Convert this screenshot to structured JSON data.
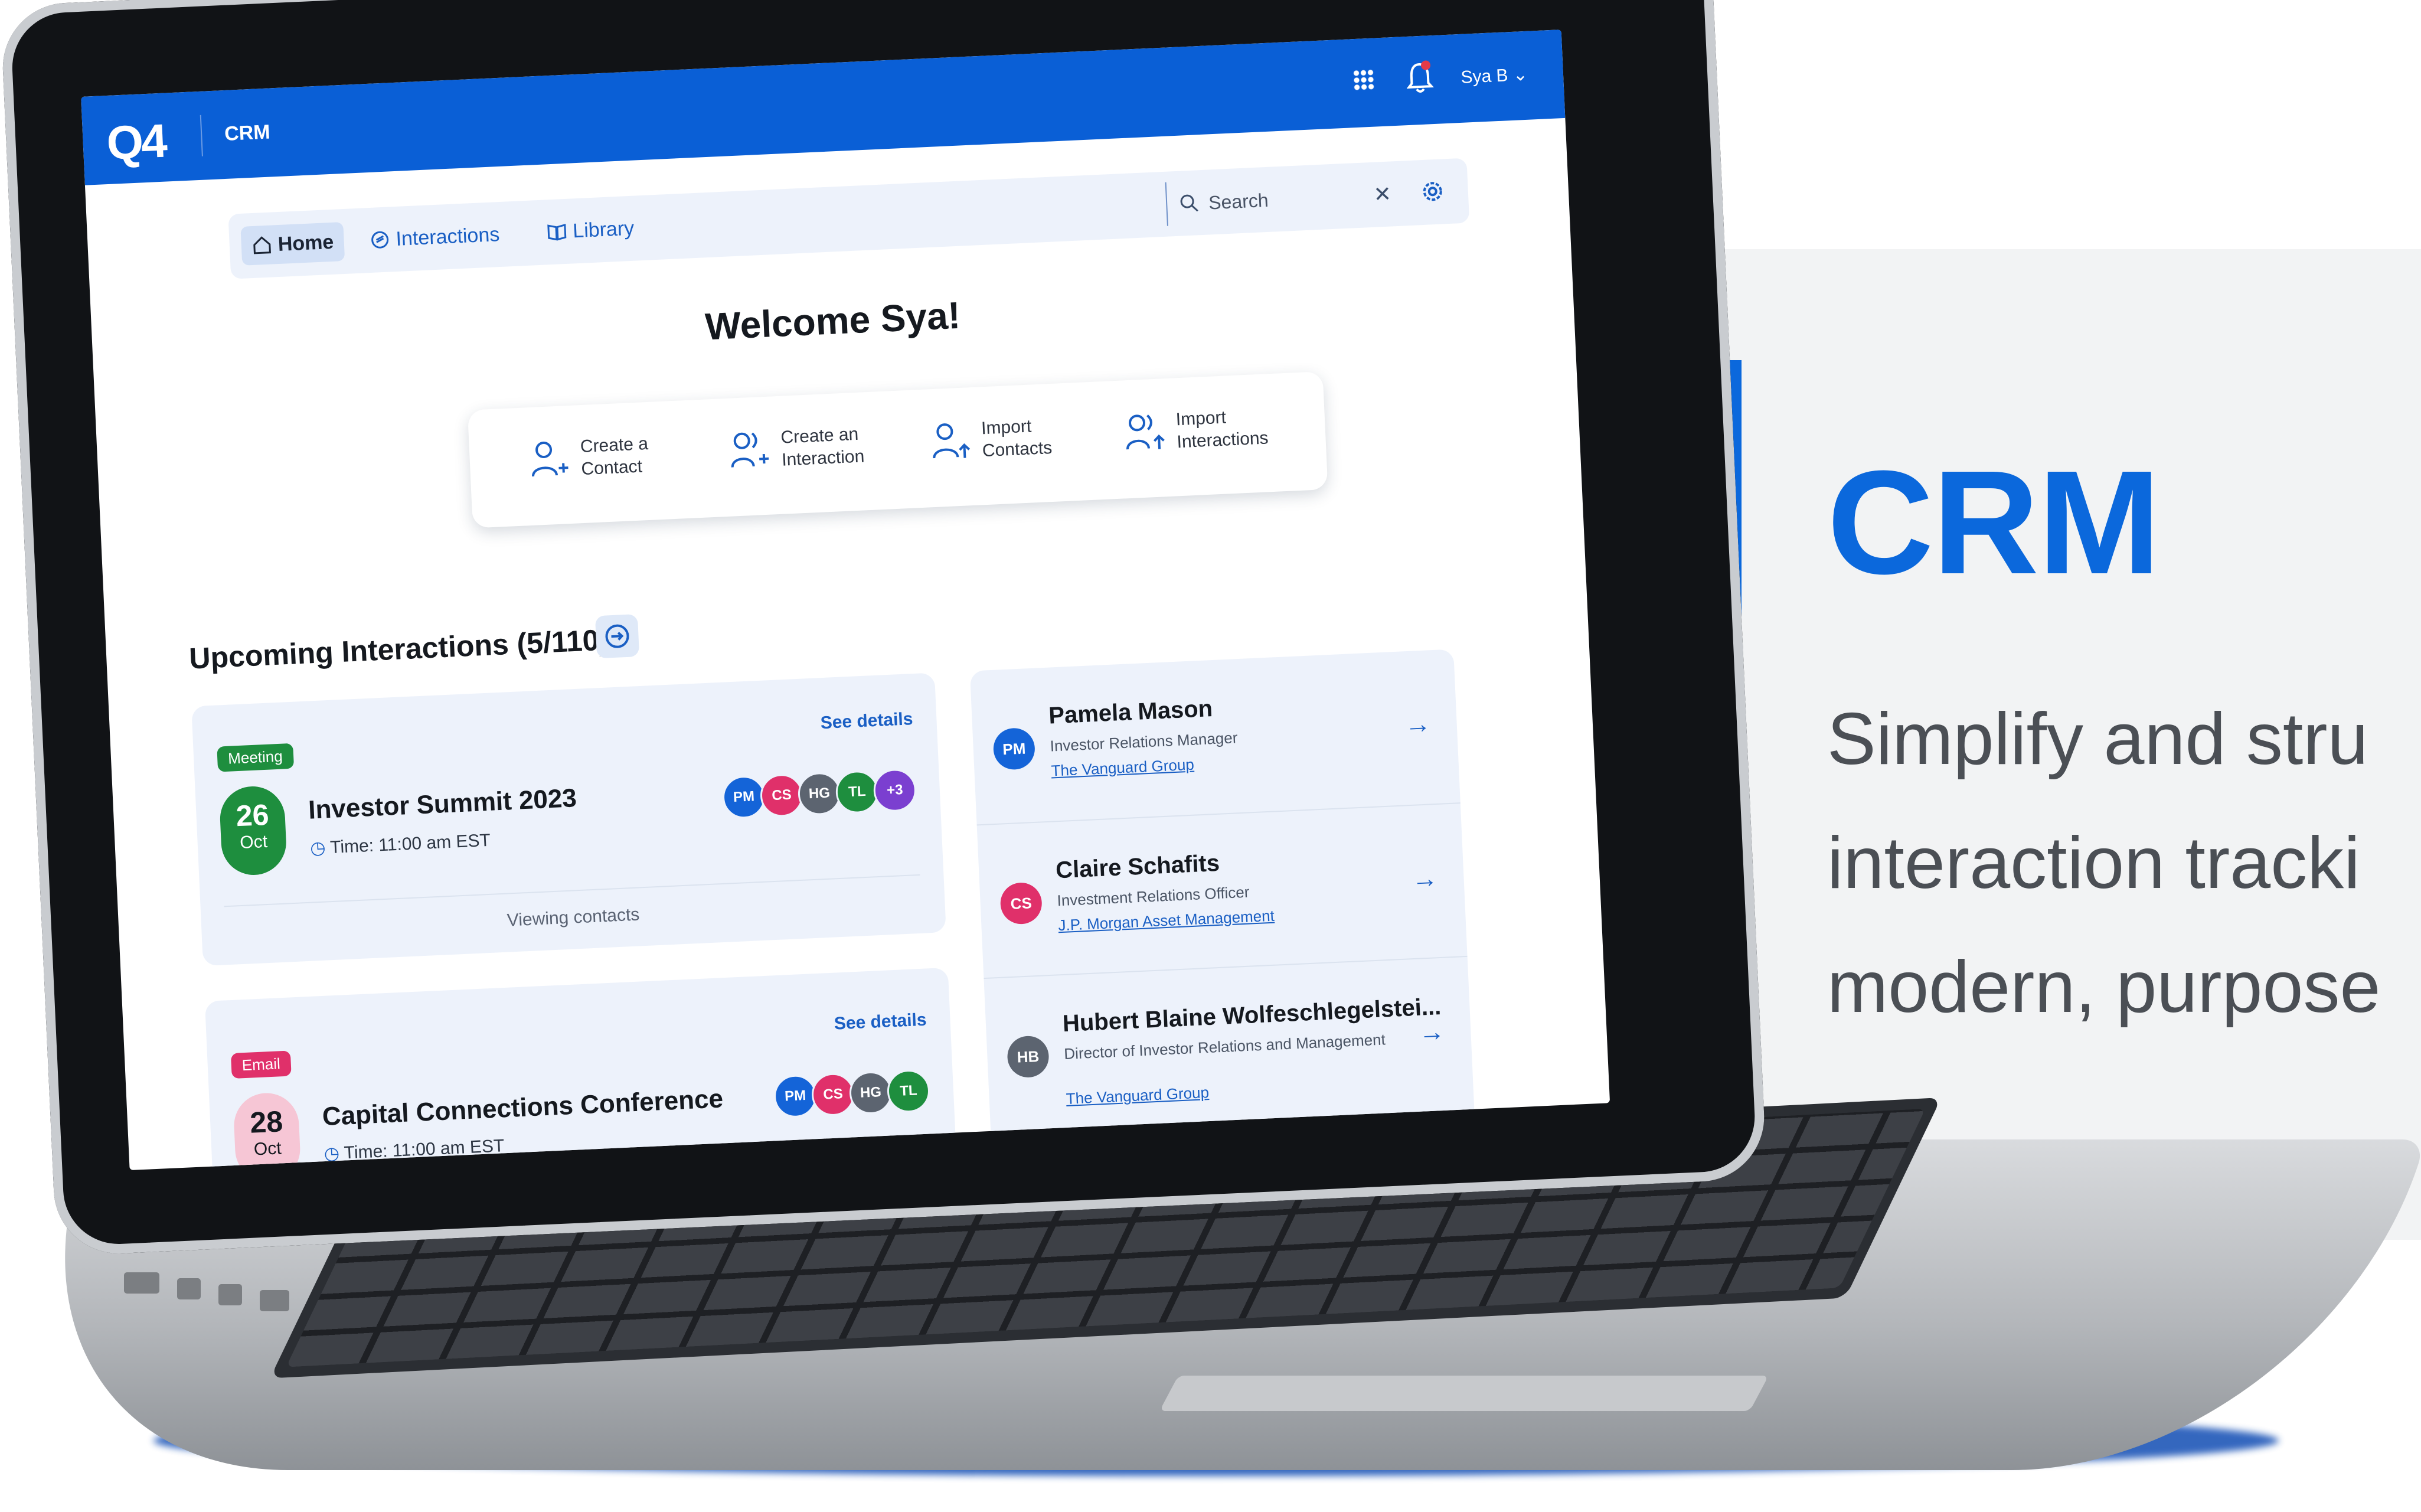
{
  "app": {
    "logo": "Q4",
    "name": "CRM",
    "user": "Sya B ⌄"
  },
  "nav": {
    "items": [
      {
        "label": "Home"
      },
      {
        "label": "Interactions"
      },
      {
        "label": "Library"
      }
    ],
    "search_label": "Search",
    "clear": "✕"
  },
  "welcome": "Welcome Sya!",
  "quick_actions": [
    {
      "label": "Create a Contact"
    },
    {
      "label": "Create an Interaction"
    },
    {
      "label": "Import Contacts"
    },
    {
      "label": "Import Interactions"
    }
  ],
  "upcoming": {
    "title": "Upcoming Interactions (5/110)",
    "items": [
      {
        "badge": "Meeting",
        "see_details": "See details",
        "day": "26",
        "month": "Oct",
        "title": "Investor Summit 2023",
        "time": "Time: 11:00 am EST",
        "attendees": [
          "PM",
          "CS",
          "HG",
          "TL",
          "+3"
        ],
        "footer": "Viewing contacts"
      },
      {
        "badge": "Email",
        "see_details": "See details",
        "day": "28",
        "month": "Oct",
        "title": "Capital Connections Conference",
        "time": "Time: 11:00 am EST",
        "attendees": [
          "PM",
          "CS",
          "HG",
          "TL"
        ]
      }
    ]
  },
  "contacts": [
    {
      "initials": "PM",
      "name": "Pamela Mason",
      "role": "Investor Relations Manager",
      "org": "The Vanguard Group",
      "color": "#1464d8"
    },
    {
      "initials": "CS",
      "name": "Claire Schafits",
      "role": "Investment Relations Officer",
      "org": "J.P. Morgan Asset Management",
      "color": "#e0306a"
    },
    {
      "initials": "HB",
      "name": "Hubert Blaine Wolfeschlegelstei...",
      "role": "Director of Investor Relations and Management",
      "org": "The Vanguard Group",
      "color": "#5c6470"
    }
  ],
  "promo": {
    "title": "CRM",
    "lines": [
      "Simplify and stru",
      "interaction tracki",
      "modern, purpose"
    ]
  },
  "colors": {
    "accent": "#0b68dc",
    "meeting": "#1e8e3e",
    "email": "#e0306a"
  }
}
